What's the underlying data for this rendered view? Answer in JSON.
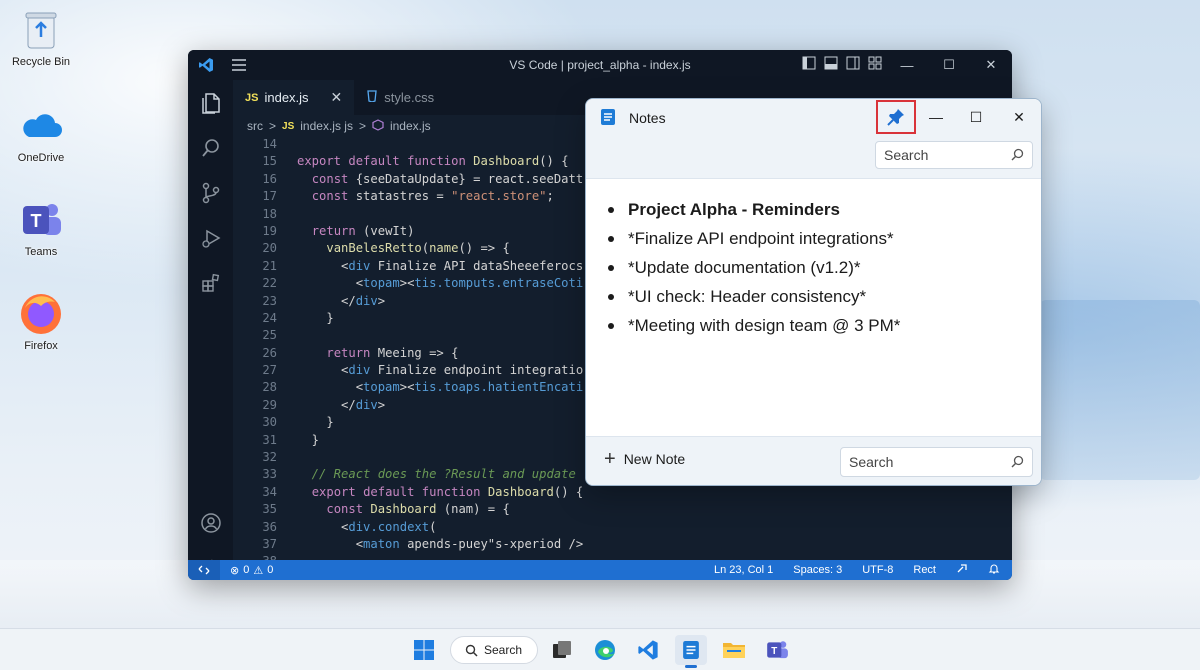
{
  "desktop": {
    "icons": [
      {
        "label": "Recycle Bin",
        "icon": "recycle-bin-icon"
      },
      {
        "label": "OneDrive",
        "icon": "onedrive-icon"
      },
      {
        "label": "Teams",
        "icon": "teams-icon"
      },
      {
        "label": "Firefox",
        "icon": "firefox-icon"
      }
    ]
  },
  "vscode": {
    "title": "VS Code | project_alpha - index.js",
    "tabs": [
      {
        "label": "index.js",
        "badge": "JS",
        "active": true
      },
      {
        "label": "style.css",
        "active": false
      }
    ],
    "breadcrumb": {
      "folder": "src",
      "sep": ">",
      "badge": "JS",
      "file": "index.js js",
      "symbol": "index.js"
    },
    "code_lines": [
      {
        "n": "14",
        "t": ""
      },
      {
        "n": "15",
        "t": "export default function Dashboard() {"
      },
      {
        "n": "16",
        "t": "  const {seeDataUpdate} = react.seeDatt"
      },
      {
        "n": "17",
        "t": "  const statastres = \"react.store\";"
      },
      {
        "n": "18",
        "t": ""
      },
      {
        "n": "19",
        "t": "  return (vewIt)"
      },
      {
        "n": "20",
        "t": "    vanBelesRetto(name() => {"
      },
      {
        "n": "21",
        "t": "      <div Finalize API dataSheeeferocs"
      },
      {
        "n": "22",
        "t": "        <topam><tis.tomputs.entraseCoti"
      },
      {
        "n": "23",
        "t": "      </div>"
      },
      {
        "n": "24",
        "t": "    }"
      },
      {
        "n": "25",
        "t": ""
      },
      {
        "n": "26",
        "t": "    return Meeing => {"
      },
      {
        "n": "27",
        "t": "      <div Finalize endpoint integratio"
      },
      {
        "n": "28",
        "t": "        <topam><tis.toaps.hatientEncati"
      },
      {
        "n": "29",
        "t": "      </div>"
      },
      {
        "n": "30",
        "t": "    }"
      },
      {
        "n": "31",
        "t": "  }"
      },
      {
        "n": "32",
        "t": ""
      },
      {
        "n": "33",
        "t": "  // React does the ?Result and update"
      },
      {
        "n": "34",
        "t": "  export default function Dashboard() {"
      },
      {
        "n": "35",
        "t": "    const Dashboard (nam) = {"
      },
      {
        "n": "36",
        "t": "      <div.condext("
      },
      {
        "n": "37",
        "t": "        <maton apends-puey\"s-xperiod />"
      },
      {
        "n": "38",
        "t": ""
      }
    ],
    "status": {
      "errors": "0",
      "warnings": "0",
      "position": "Ln 23, Col 1",
      "spaces": "Spaces: 3",
      "encoding": "UTF-8",
      "language": "Rect"
    }
  },
  "notes": {
    "title": "Notes",
    "search_placeholder_top": "Search",
    "items": [
      {
        "text": "Project Alpha - Reminders",
        "bold": true
      },
      {
        "text": "*Finalize API endpoint integrations*",
        "bold": false
      },
      {
        "text": "*Update documentation (v1.2)*",
        "bold": false
      },
      {
        "text": "*UI check: Header consistency*",
        "bold": false
      },
      {
        "text": "*Meeting with design team @ 3 PM*",
        "bold": false
      }
    ],
    "new_note_label": "New Note",
    "search_placeholder_bottom": "Search"
  },
  "taskbar": {
    "search_label": "Search",
    "items": [
      "start-icon",
      "task-view-icon",
      "edge-icon",
      "vscode-icon",
      "notes-icon",
      "file-explorer-icon",
      "teams-icon"
    ],
    "active": "notes-icon"
  },
  "colors": {
    "vscode_bg": "#131e2d",
    "status_bar": "#1f6fd1",
    "pin_highlight": "#d9333a"
  }
}
